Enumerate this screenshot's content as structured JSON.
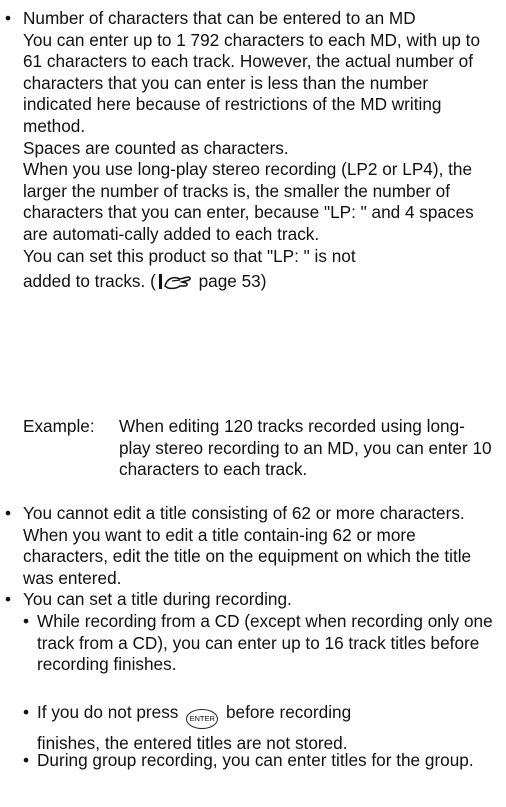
{
  "section1": {
    "bullet": "•",
    "heading": "Number of characters that can be entered to an MD",
    "p1": "You can enter up to 1 792 characters to each MD, with up to 61 characters to each track. However, the actual number of characters that you can enter is less than the number indicated here because of restrictions of the MD writing method.",
    "p2": "Spaces are counted as characters.",
    "p3": "When you use long-play stereo recording (LP2 or LP4), the larger the number of tracks is, the smaller the number of characters that you can enter, because \"LP: \" and 4 spaces are automati-cally added to each track.",
    "p4_line1": "You can set this product so that \"LP: \" is not",
    "p4_line2_a": "added to tracks. (",
    "p4_line2_icon": "reference-pointer-icon",
    "p4_line2_b": " page 53)",
    "example_label": "Example:",
    "example_text": "When editing 120 tracks recorded using long-play stereo recording to an MD, you can enter 10 characters to each track."
  },
  "section2": {
    "bullet": "•",
    "text": "You cannot edit a title consisting of 62 or more characters. When you want to edit a title contain-ing 62 or more characters, edit the title on the equipment on which the title was entered."
  },
  "section3": {
    "bullet": "•",
    "text": "You can set a title during recording.",
    "sub1": "While recording from a CD (except when recording only one track from a CD), you can enter up to 16 track titles before recording finishes.",
    "sub2_a": "If you do not press ",
    "sub2_icon_label": "ENTER",
    "sub2_b": " before recording",
    "sub2_c": "finishes, the entered titles are not stored.",
    "sub3": "During group recording, you can enter titles for the group."
  }
}
